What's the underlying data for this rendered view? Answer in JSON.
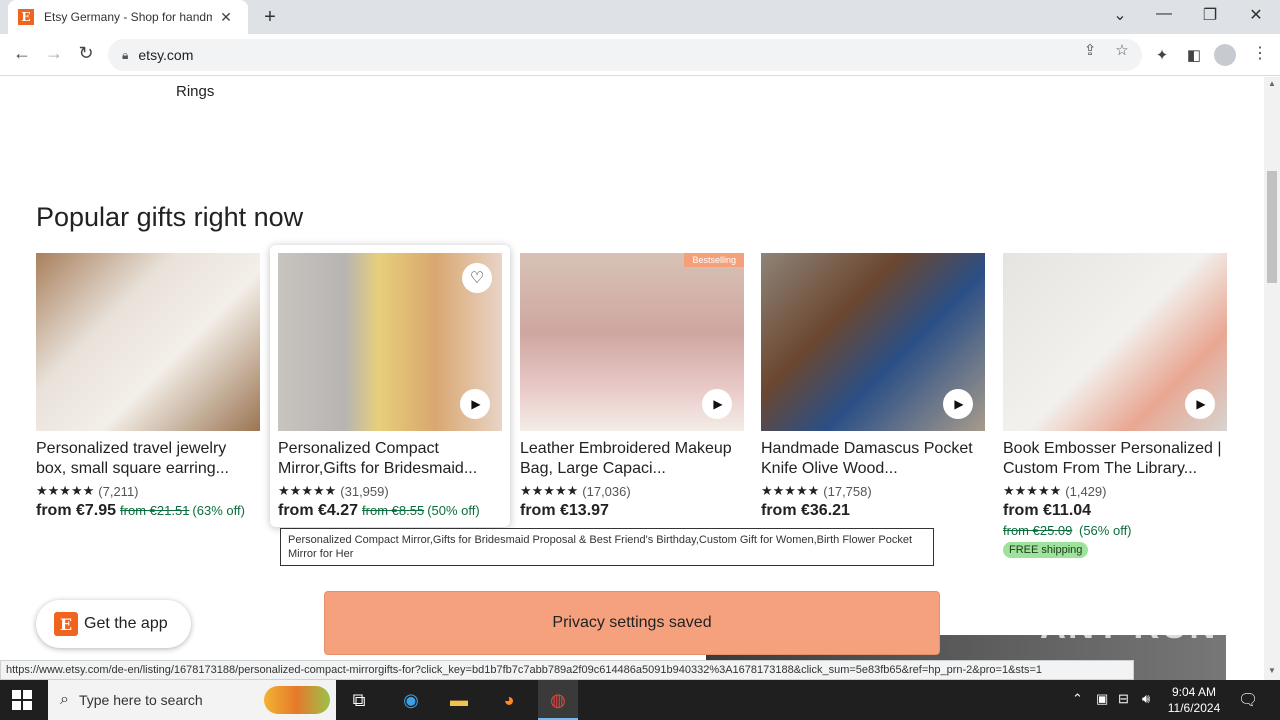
{
  "browser": {
    "tab_title": "Etsy Germany - Shop for handmade",
    "tab_favicon": "E",
    "new_tab": "+",
    "url": "etsy.com",
    "status_url": "https://www.etsy.com/de-en/listing/1678173188/personalized-compact-mirrorgifts-for?click_key=bd1b7fb7c7abb789a2f09c614486a5091b940332%3A1678173188&click_sum=5e83fb65&ref=hp_prn-2&pro=1&sts=1"
  },
  "page": {
    "partial_label": "Rings",
    "section_title": "Popular gifts right now",
    "products": [
      {
        "title": "Personalized travel jewelry box, small square earring...",
        "stars": "★★★★★",
        "reviews": "(7,211)",
        "price": "from €7.95",
        "orig": "from €21.51",
        "discount": "(63% off)"
      },
      {
        "title": "Personalized Compact Mirror,Gifts for Bridesmaid...",
        "stars": "★★★★★",
        "reviews": "(31,959)",
        "price": "from €4.27",
        "orig": "from €8.55",
        "discount": "(50% off)"
      },
      {
        "title": "Leather Embroidered Makeup Bag, Large Capaci...",
        "stars": "★★★★★",
        "reviews": "(17,036)",
        "price": "from €13.97",
        "badge": "Bestselling"
      },
      {
        "title": "Handmade Damascus Pocket Knife Olive Wood...",
        "stars": "★★★★★",
        "reviews": "(17,758)",
        "price": "from €36.21"
      },
      {
        "title": "Book Embosser Personalized | Custom From The Library...",
        "stars": "★★★★★",
        "reviews": "(1,429)",
        "price": "from €11.04",
        "orig": "from €25.09",
        "discount": "(56% off)",
        "shipping": "FREE shipping"
      }
    ],
    "tooltip": "Personalized Compact Mirror,Gifts for Bridesmaid Proposal & Best Friend's Birthday,Custom Gift for Women,Birth Flower Pocket Mirror for Her",
    "get_app_label": "Get the app",
    "get_app_logo": "E",
    "toast": "Privacy settings saved",
    "watermark": "ANY RUN"
  },
  "taskbar": {
    "search_placeholder": "Type here to search",
    "time": "9:04 AM",
    "date": "11/6/2024"
  },
  "colors": {
    "etsy_orange": "#f1641e",
    "toast_bg": "#f5a17e",
    "discount_green": "#0b6e3e",
    "free_shipping_bg": "#9ee29b"
  }
}
